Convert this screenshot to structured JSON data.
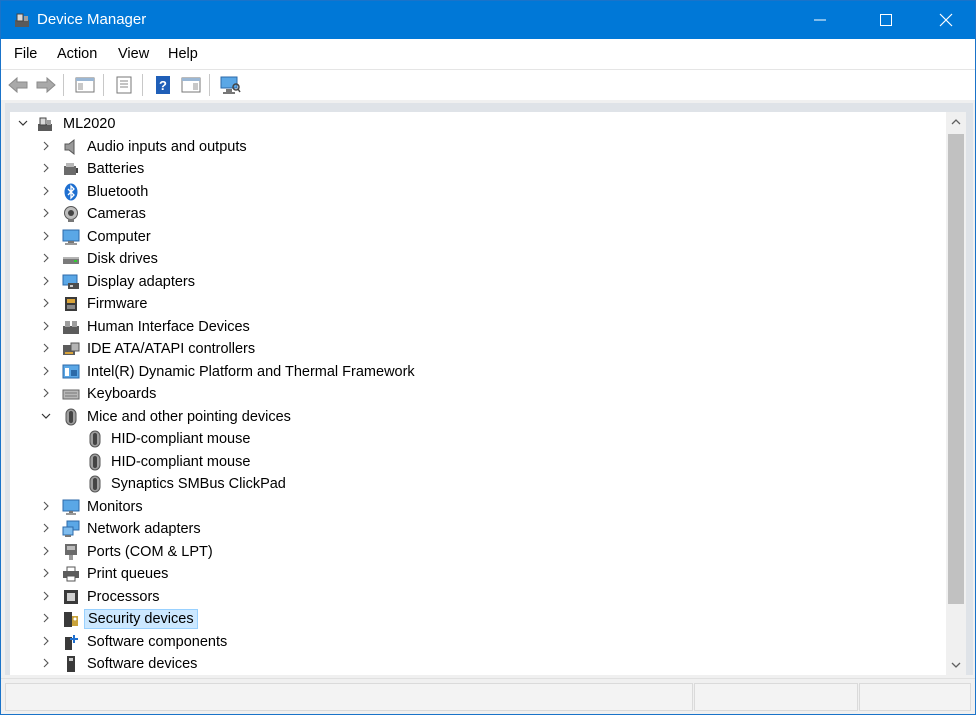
{
  "window": {
    "title": "Device Manager",
    "accent": "#0078d7"
  },
  "menu": [
    "File",
    "Action",
    "View",
    "Help"
  ],
  "toolbar": [
    "back-icon",
    "forward-icon",
    "show-hide-console-tree-icon",
    "properties-icon",
    "help-icon",
    "action-pane-icon",
    "scan-hardware-icon"
  ],
  "tree": {
    "root": "ML2020",
    "items": [
      {
        "label": "Audio inputs and outputs",
        "icon": "speaker-icon"
      },
      {
        "label": "Batteries",
        "icon": "battery-icon"
      },
      {
        "label": "Bluetooth",
        "icon": "bluetooth-icon"
      },
      {
        "label": "Cameras",
        "icon": "camera-icon"
      },
      {
        "label": "Computer",
        "icon": "computer-icon"
      },
      {
        "label": "Disk drives",
        "icon": "disk-drive-icon"
      },
      {
        "label": "Display adapters",
        "icon": "display-adapter-icon"
      },
      {
        "label": "Firmware",
        "icon": "firmware-icon"
      },
      {
        "label": "Human Interface Devices",
        "icon": "hid-icon"
      },
      {
        "label": "IDE ATA/ATAPI controllers",
        "icon": "ide-controller-icon"
      },
      {
        "label": "Intel(R) Dynamic Platform and Thermal Framework",
        "icon": "thermal-framework-icon"
      },
      {
        "label": "Keyboards",
        "icon": "keyboard-icon"
      },
      {
        "label": "Mice and other pointing devices",
        "icon": "mouse-icon",
        "expanded": true,
        "children": [
          "HID-compliant mouse",
          "HID-compliant mouse",
          "Synaptics SMBus ClickPad"
        ]
      },
      {
        "label": "Monitors",
        "icon": "monitor-icon"
      },
      {
        "label": "Network adapters",
        "icon": "network-adapter-icon"
      },
      {
        "label": "Ports (COM & LPT)",
        "icon": "port-icon"
      },
      {
        "label": "Print queues",
        "icon": "printer-icon"
      },
      {
        "label": "Processors",
        "icon": "processor-icon"
      },
      {
        "label": "Security devices",
        "icon": "security-device-icon",
        "selected": true
      },
      {
        "label": "Software components",
        "icon": "software-component-icon"
      },
      {
        "label": "Software devices",
        "icon": "software-device-icon"
      }
    ]
  }
}
